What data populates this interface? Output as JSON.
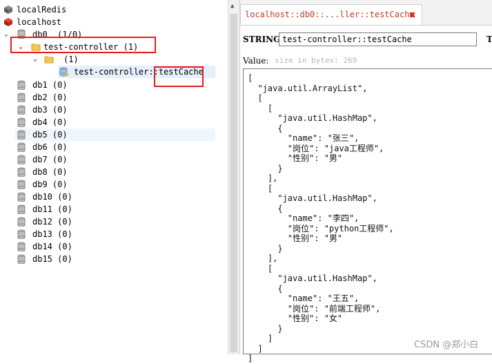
{
  "tree": {
    "connections": [
      "localRedis",
      "localhost"
    ],
    "db0": {
      "name": "db0",
      "count": "(1/0)"
    },
    "namespace": {
      "name": "test-controller",
      "count": "(1)"
    },
    "subfolder": {
      "count": "(1)"
    },
    "key": {
      "prefix": "test-controller::",
      "name": "testCache"
    },
    "databases": [
      {
        "name": "db1",
        "count": "(0)"
      },
      {
        "name": "db2",
        "count": "(0)"
      },
      {
        "name": "db3",
        "count": "(0)"
      },
      {
        "name": "db4",
        "count": "(0)"
      },
      {
        "name": "db5",
        "count": "(0)"
      },
      {
        "name": "db6",
        "count": "(0)"
      },
      {
        "name": "db7",
        "count": "(0)"
      },
      {
        "name": "db8",
        "count": "(0)"
      },
      {
        "name": "db9",
        "count": "(0)"
      },
      {
        "name": "db10",
        "count": "(0)"
      },
      {
        "name": "db11",
        "count": "(0)"
      },
      {
        "name": "db12",
        "count": "(0)"
      },
      {
        "name": "db13",
        "count": "(0)"
      },
      {
        "name": "db14",
        "count": "(0)"
      },
      {
        "name": "db15",
        "count": "(0)"
      }
    ]
  },
  "tab": {
    "title": "localhost::db0::...ller::testCache"
  },
  "key_panel": {
    "type_label": "STRING:",
    "key_value": "test-controller::testCache",
    "ttl_label": "T",
    "value_label": "Value:",
    "size_hint": "size in bytes: 269"
  },
  "value_lines": [
    "[",
    "  \"java.util.ArrayList\",",
    "  [",
    "    [",
    "      \"java.util.HashMap\",",
    "      {",
    "        \"name\": \"张三\",",
    "        \"岗位\": \"java工程师\",",
    "        \"性别\": \"男\"",
    "      }",
    "    ],",
    "    [",
    "      \"java.util.HashMap\",",
    "      {",
    "        \"name\": \"李四\",",
    "        \"岗位\": \"python工程师\",",
    "        \"性别\": \"男\"",
    "      }",
    "    ],",
    "    [",
    "      \"java.util.HashMap\",",
    "      {",
    "        \"name\": \"王五\",",
    "        \"岗位\": \"前端工程师\",",
    "        \"性别\": \"女\"",
    "      }",
    "    ]",
    "  ]",
    "]"
  ],
  "watermark": "CSDN @郑小白",
  "colors": {
    "highlight_box": "#e8191c",
    "tab_text": "#c0392b",
    "close_icon": "#e2231a",
    "selection": "#e6f0fb"
  }
}
